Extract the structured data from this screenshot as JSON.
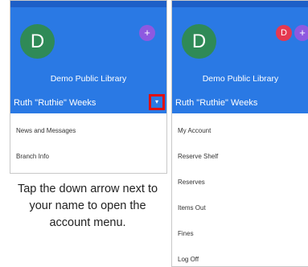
{
  "left_panel": {
    "avatar_letter": "D",
    "add_account_symbol": "+",
    "library_name": "Demo Public Library",
    "user_name": "Ruth \"Ruthie\" Weeks",
    "dropdown_symbol": "▾",
    "menu_items": [
      "News and Messages",
      "Branch Info"
    ]
  },
  "right_panel": {
    "avatar_letter": "D",
    "switch_account_letter": "D",
    "add_account_symbol": "+",
    "library_name": "Demo Public Library",
    "user_name": "Ruth \"Ruthie\" Weeks",
    "account_menu_items": [
      "My Account",
      "Reserve Shelf",
      "Reserves",
      "Items Out",
      "Fines",
      "Log Off"
    ]
  },
  "caption": "Tap the down arrow next to your name to open the account menu.",
  "colors": {
    "header_blue": "#2a79e4",
    "status_bar_blue": "#1d5fc7",
    "avatar_green": "#2f8a57",
    "add_account_purple": "#8e59e0",
    "switch_account_red": "#e53950",
    "highlight_red": "#e01010"
  },
  "icons": {
    "add_account": "plus-icon",
    "dropdown": "chevron-down-icon"
  }
}
